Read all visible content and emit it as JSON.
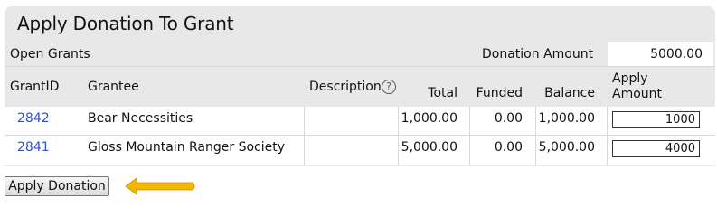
{
  "title": "Apply Donation To Grant",
  "open_grants_label": "Open Grants",
  "donation_amount_label": "Donation Amount",
  "donation_amount_value": "5000.00",
  "columns": {
    "grant_id": "GrantID",
    "grantee": "Grantee",
    "description": "Description",
    "total": "Total",
    "funded": "Funded",
    "balance": "Balance",
    "apply_amount_line1": "Apply",
    "apply_amount_line2": "Amount"
  },
  "rows": [
    {
      "grant_id": "2842",
      "grantee": "Bear Necessities",
      "description": "",
      "total": "1,000.00",
      "funded": "0.00",
      "balance": "1,000.00",
      "apply_amount": "1000"
    },
    {
      "grant_id": "2841",
      "grantee": "Gloss Mountain Ranger Society",
      "description": "",
      "total": "5,000.00",
      "funded": "0.00",
      "balance": "5,000.00",
      "apply_amount": "4000"
    }
  ],
  "apply_button_label": "Apply Donation",
  "colors": {
    "panel_bg": "#e8e8e8",
    "link": "#2f55c9",
    "arrow": "#f2b705"
  },
  "icons": {
    "description_help": "help-icon",
    "pointer": "arrow-left-icon"
  }
}
